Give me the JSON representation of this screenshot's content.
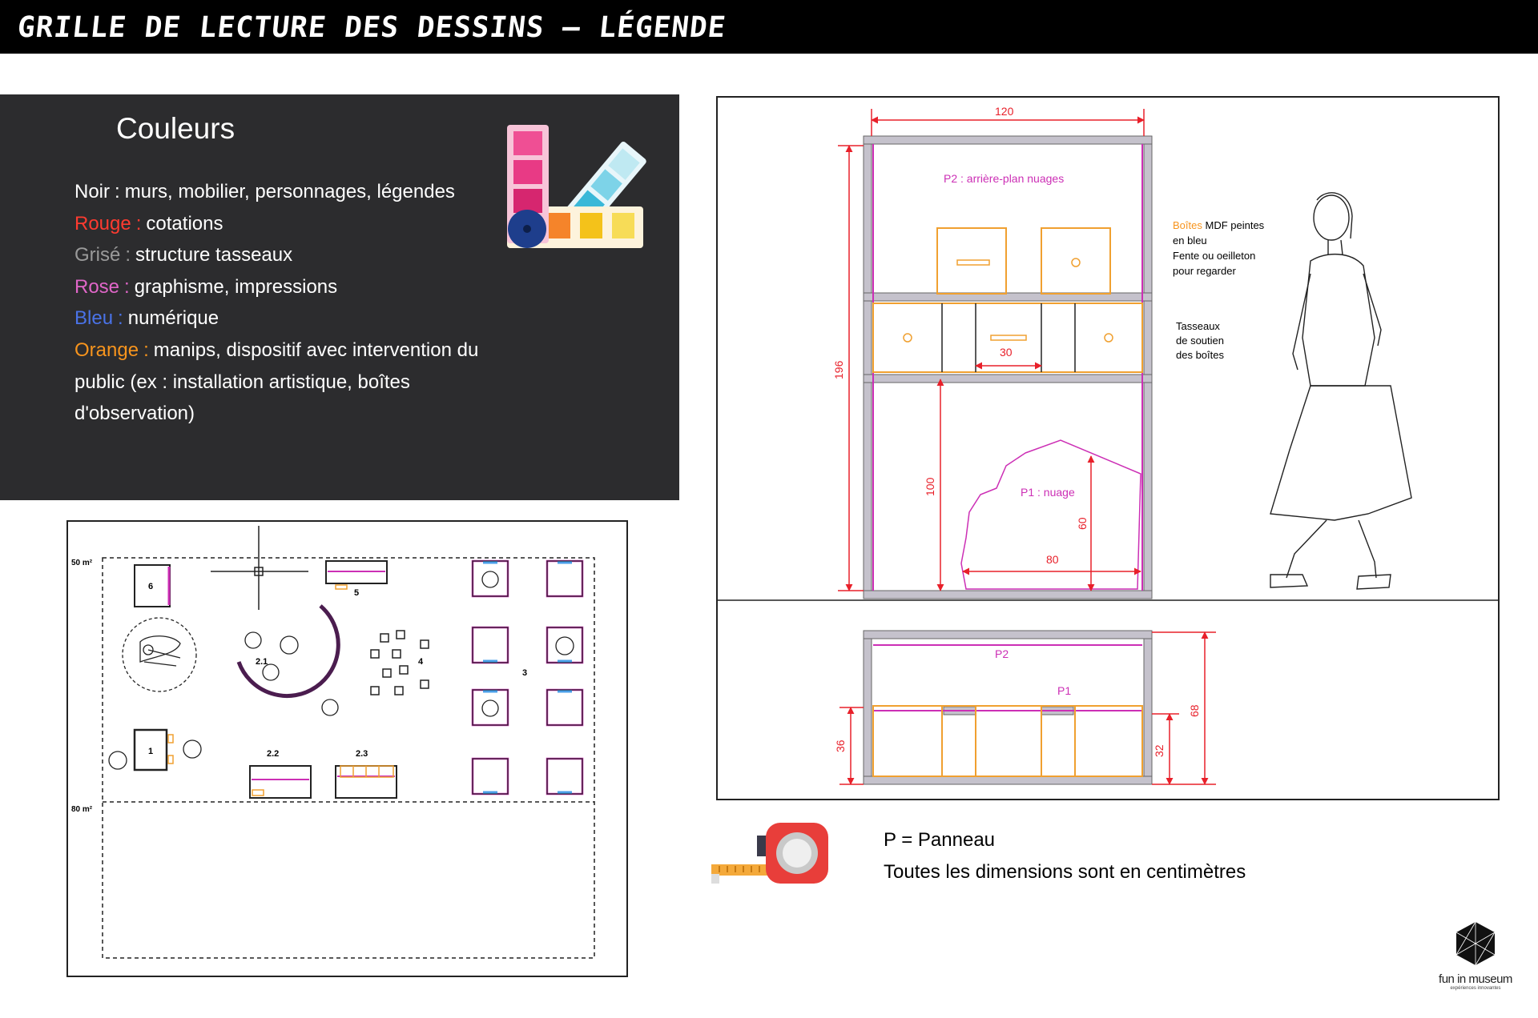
{
  "header": {
    "title": "GRILLE DE LECTURE DES DESSINS – LÉGENDE"
  },
  "legend": {
    "heading": "Couleurs",
    "separator": ":",
    "items": [
      {
        "key": "Noir",
        "desc": "murs, mobilier, personnages, légendes",
        "color": "#ffffff"
      },
      {
        "key": "Rouge",
        "desc": "cotations",
        "color": "#ff3b30"
      },
      {
        "key": "Grisé",
        "desc": "structure tasseaux",
        "color": "#9a9a9a"
      },
      {
        "key": "Rose",
        "desc": "graphisme, impressions",
        "color": "#e066c8"
      },
      {
        "key": "Bleu",
        "desc": "numérique",
        "color": "#4a73e8"
      },
      {
        "key": "Orange",
        "desc": "manips, dispositif avec intervention du public (ex : installation artistique, boîtes d'observation)",
        "color": "#f7941d"
      }
    ]
  },
  "floor_plan": {
    "area_top": "50 m²",
    "area_bottom": "80 m²",
    "labels": {
      "z1": "1",
      "z21": "2.1",
      "z22": "2.2",
      "z23": "2.3",
      "z3": "3",
      "z4": "4",
      "z5": "5",
      "z6": "6"
    }
  },
  "elevation": {
    "dim_width": "120",
    "dim_height": "196",
    "dim_slot": "30",
    "dim_lower": "100",
    "dim_cloud_w": "80",
    "dim_cloud_h": "60",
    "label_p2": "P2 : arrière-plan nuages",
    "label_p1": "P1 : nuage",
    "note_boxes_key": "Boîtes",
    "note_boxes_rest": "MDF peintes",
    "note_boxes_l2": "en bleu",
    "note_boxes_l3": "Fente ou oeilleton",
    "note_boxes_l4": "pour regarder",
    "note_tasseaux_l1": "Tasseaux",
    "note_tasseaux_l2": "de soutien",
    "note_tasseaux_l3": "des boîtes",
    "plan_p2": "P2",
    "plan_p1": "P1",
    "dim_36": "36",
    "dim_32": "32",
    "dim_68": "68"
  },
  "notes": {
    "panel": "P = Panneau",
    "units": "Toutes les dimensions sont en centimètres"
  },
  "logo": {
    "name": "fun in museum",
    "tagline": "expériences innovantes"
  },
  "colors": {
    "dimension": "#e8202a",
    "pink": "#cc2fb5",
    "orange": "#f0a030",
    "gray": "#b9b3c1",
    "blue": "#4a73e8"
  }
}
